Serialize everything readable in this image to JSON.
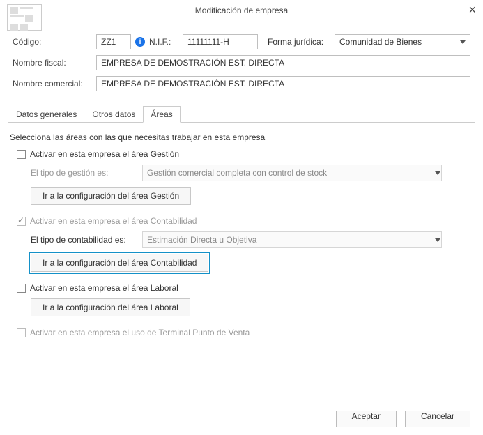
{
  "window": {
    "title": "Modificación de empresa"
  },
  "labels": {
    "codigo": "Código:",
    "nif": "N.I.F.:",
    "forma": "Forma jurídica:",
    "nombre_fiscal": "Nombre fiscal:",
    "nombre_comercial": "Nombre comercial:"
  },
  "values": {
    "codigo": "ZZ1",
    "nif": "11111111-H",
    "forma_juridica": "Comunidad de Bienes",
    "nombre_fiscal": "EMPRESA DE DEMOSTRACIÓN EST. DIRECTA",
    "nombre_comercial": "EMPRESA DE DEMOSTRACIÓN EST. DIRECTA"
  },
  "tabs": {
    "generales": "Datos generales",
    "otros": "Otros datos",
    "areas": "Áreas"
  },
  "areas": {
    "intro": "Selecciona las áreas con las que necesitas trabajar en esta empresa",
    "gestion": {
      "chk": "Activar en esta empresa el área Gestión",
      "tipo_lbl": "El tipo de gestión es:",
      "tipo_val": "Gestión comercial completa con control de stock",
      "btn": "Ir a la configuración del área Gestión"
    },
    "contabilidad": {
      "chk": "Activar en esta empresa el área Contabilidad",
      "tipo_lbl": "El tipo de contabilidad es:",
      "tipo_val": "Estimación Directa u Objetiva",
      "btn": "Ir a la configuración del área Contabilidad"
    },
    "laboral": {
      "chk": "Activar en esta empresa el área Laboral",
      "btn": "Ir a la configuración del área Laboral"
    },
    "tpv": {
      "chk": "Activar en esta empresa el uso de Terminal Punto de Venta"
    }
  },
  "footer": {
    "aceptar": "Aceptar",
    "cancelar": "Cancelar"
  }
}
